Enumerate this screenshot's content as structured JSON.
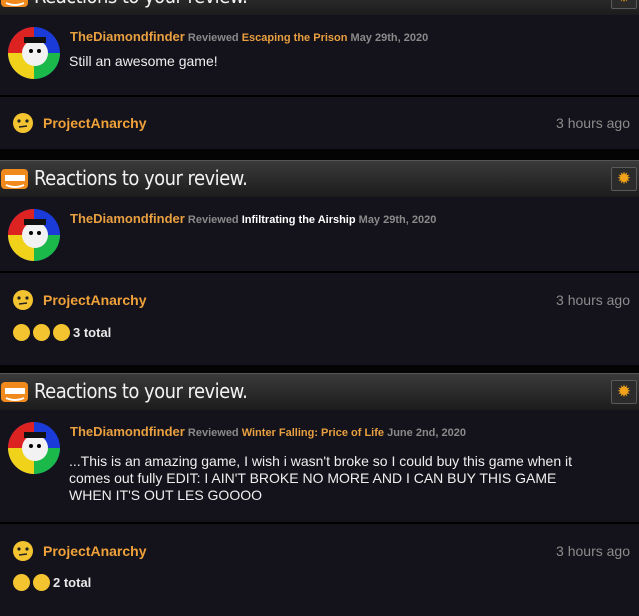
{
  "panels": [
    {
      "title": "Reactions to your review.",
      "reviewer": "TheDiamondfinder",
      "reviewed_label": "Reviewed",
      "game": "Escaping the Prison",
      "date": "May 29th, 2020",
      "body": "Still an awesome game!",
      "reactor": "ProjectAnarchy",
      "time": "3 hours ago",
      "total": ""
    },
    {
      "title": "Reactions to your review.",
      "reviewer": "TheDiamondfinder",
      "reviewed_label": "Reviewed",
      "game": "Infiltrating the Airship",
      "date": "May 29th, 2020",
      "body": "",
      "reactor": "ProjectAnarchy",
      "time": "3 hours ago",
      "total": "3 total"
    },
    {
      "title": "Reactions to your review.",
      "reviewer": "TheDiamondfinder",
      "reviewed_label": "Reviewed",
      "game": "Winter Falling: Price of Life",
      "date": "June 2nd, 2020",
      "body": "...This is an amazing game, I wish i wasn't broke so I could buy this game when it comes out fully EDIT: I AIN'T BROKE NO MORE AND I CAN BUY THIS GAME WHEN IT'S OUT LES GOOOO",
      "reactor": "ProjectAnarchy",
      "time": "3 hours ago",
      "total": "2 total"
    }
  ],
  "colors": {
    "accent": "#e8a040",
    "gear": "#f2a31b",
    "panel_bg": "#14121a"
  },
  "icons": {
    "header": "orange-face-icon",
    "settings": "gear-icon",
    "reaction": "smiley-icon"
  }
}
